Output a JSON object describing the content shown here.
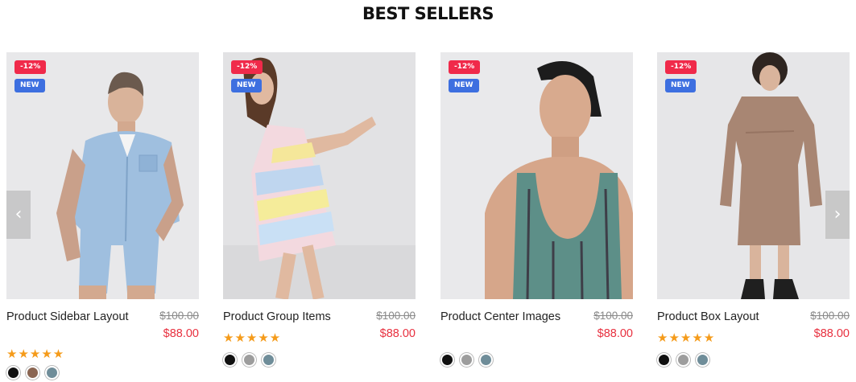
{
  "section": {
    "title": "BEST SELLERS"
  },
  "colors": {
    "sale_badge": "#f02a4a",
    "new_badge": "#3d6fe0",
    "price": "#e8303f",
    "star": "#f59b1a"
  },
  "products": [
    {
      "name": "Product Sidebar Layout",
      "sale_badge": "-12%",
      "new_badge": "NEW",
      "old_price": "$100.00",
      "price": "$88.00",
      "rating": 5,
      "stars": "★★★★★",
      "swatches": [
        "#111111",
        "#8a6552",
        "#6f8d99"
      ]
    },
    {
      "name": "Product Group Items",
      "sale_badge": "-12%",
      "new_badge": "NEW",
      "old_price": "$100.00",
      "price": "$88.00",
      "rating": 5,
      "stars": "★★★★★",
      "swatches": [
        "#111111",
        "#9d9d9d",
        "#6f8d99"
      ]
    },
    {
      "name": "Product Center Images",
      "sale_badge": "-12%",
      "new_badge": "NEW",
      "old_price": "$100.00",
      "price": "$88.00",
      "rating": null,
      "stars": "",
      "swatches": [
        "#111111",
        "#9d9d9d",
        "#6f8d99"
      ]
    },
    {
      "name": "Product Box Layout",
      "sale_badge": "-12%",
      "new_badge": "NEW",
      "old_price": "$100.00",
      "price": "$88.00",
      "rating": 5,
      "stars": "★★★★★",
      "swatches": [
        "#111111",
        "#9d9d9d",
        "#6f8d99"
      ]
    }
  ],
  "nav": {
    "prev_icon": "chevron-left-icon",
    "next_icon": "chevron-right-icon",
    "prev_glyph": "‹",
    "next_glyph": "›"
  }
}
